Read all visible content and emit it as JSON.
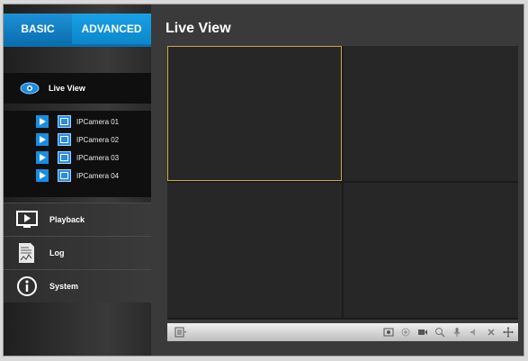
{
  "tabs": {
    "basic": "BASIC",
    "advanced": "ADVANCED"
  },
  "sidebar": {
    "live_view": "Live View",
    "cameras": [
      "IPCamera 01",
      "IPCamera 02",
      "IPCamera 03",
      "IPCamera 04"
    ],
    "items": [
      {
        "label": "Playback",
        "icon": "playback-icon"
      },
      {
        "label": "Log",
        "icon": "log-icon"
      },
      {
        "label": "System",
        "icon": "info-icon"
      }
    ]
  },
  "main": {
    "title": "Live View"
  },
  "colors": {
    "accent": "#1a8de0",
    "selected_border": "#c8a64a"
  }
}
